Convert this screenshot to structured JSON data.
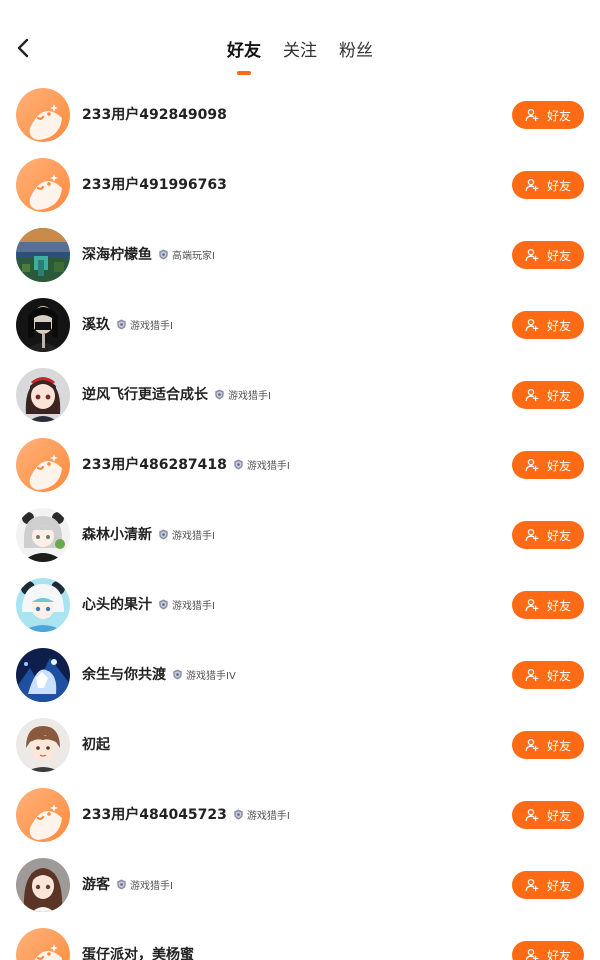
{
  "header": {
    "back_icon": "chevron-left-icon",
    "tabs": [
      {
        "label": "好友",
        "active": true
      },
      {
        "label": "关注",
        "active": false
      },
      {
        "label": "粉丝",
        "active": false
      }
    ]
  },
  "colors": {
    "accent": "#ff6a14",
    "background": "#ffffff"
  },
  "friends": [
    {
      "name": "233用户492849098",
      "badge": "",
      "avatar": "default-orange",
      "button": "好友"
    },
    {
      "name": "233用户491996763",
      "badge": "",
      "avatar": "default-orange",
      "button": "好友"
    },
    {
      "name": "深海柠檬鱼",
      "badge": "高端玩家I",
      "avatar": "minecraft-landscape",
      "button": "好友"
    },
    {
      "name": "溪玖",
      "badge": "游戏猎手I",
      "avatar": "dark-portrait",
      "button": "好友"
    },
    {
      "name": "逆风飞行更适合成长",
      "badge": "游戏猎手I",
      "avatar": "anime-girl-red",
      "button": "好友"
    },
    {
      "name": "233用户486287418",
      "badge": "游戏猎手I",
      "avatar": "default-orange",
      "button": "好友"
    },
    {
      "name": "森林小清新",
      "badge": "游戏猎手I",
      "avatar": "anime-panda-hoodie",
      "button": "好友"
    },
    {
      "name": "心头的果汁",
      "badge": "游戏猎手I",
      "avatar": "anime-panda-blue",
      "button": "好友"
    },
    {
      "name": "余生与你共渡",
      "badge": "游戏猎手IV",
      "avatar": "anime-blue-ice",
      "button": "好友"
    },
    {
      "name": "初起",
      "badge": "",
      "avatar": "anime-boy",
      "button": "好友"
    },
    {
      "name": "233用户484045723",
      "badge": "游戏猎手I",
      "avatar": "default-orange",
      "button": "好友"
    },
    {
      "name": "游客",
      "badge": "游戏猎手I",
      "avatar": "anime-girl-brown",
      "button": "好友"
    },
    {
      "name": "蛋仔派对，美杨蜜",
      "badge": "",
      "avatar": "default-orange",
      "button": "好友"
    }
  ]
}
